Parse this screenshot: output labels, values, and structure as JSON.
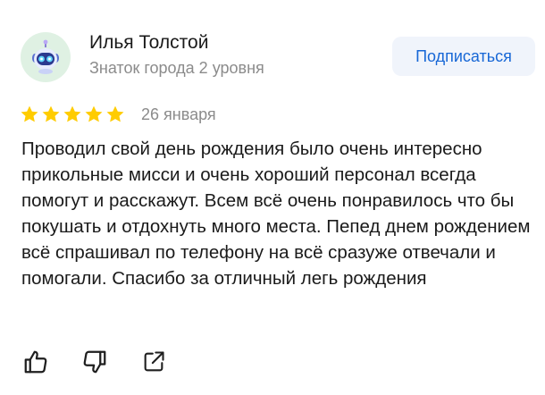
{
  "author": {
    "name": "Илья Толстой",
    "level": "Знаток города 2 уровня",
    "avatar_icon": "robot-avatar-icon"
  },
  "subscribe_label": "Подписаться",
  "rating": {
    "value": 5,
    "max": 5,
    "color": "#ffcc00"
  },
  "date": "26 января",
  "text": "Проводил свой день рождения было очень интересно прикольные мисси и очень хороший персонал всегда помогут и расскажут. Всем всё очень понравилось что бы покушать и отдохнуть много места. Пепед днем рождением всё спрашивал по телефону на всё сразуже отвечали и помогали. Спасибо за отличный легь рождения",
  "actions": [
    {
      "icon": "thumbs-up-icon"
    },
    {
      "icon": "thumbs-down-icon"
    },
    {
      "icon": "share-icon"
    }
  ],
  "colors": {
    "accent": "#1767d6",
    "secondary_text": "#8b8b8b",
    "button_bg": "#f0f4fb",
    "avatar_bg": "#dff1e3"
  }
}
